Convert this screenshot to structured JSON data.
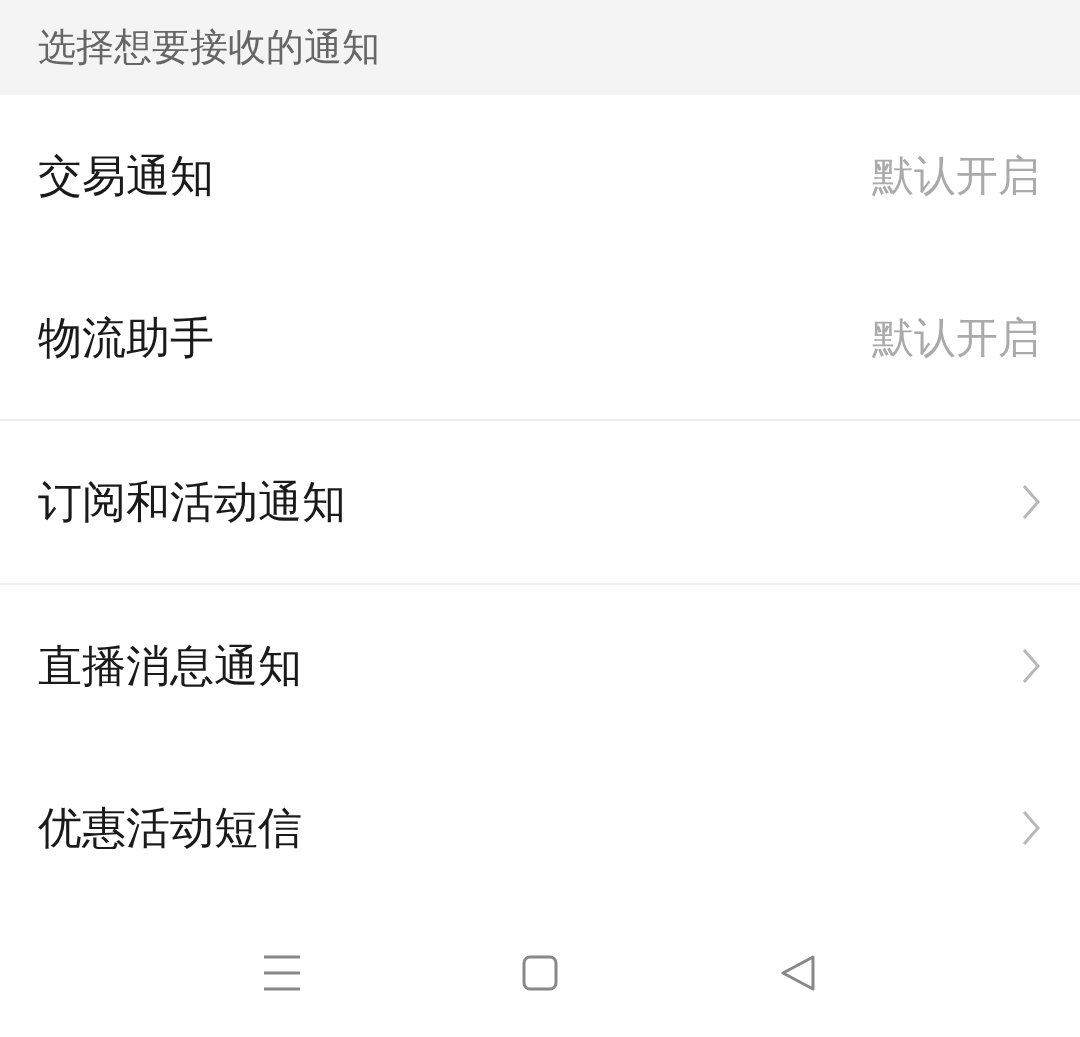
{
  "section_header": "选择想要接收的通知",
  "groups": [
    {
      "items": [
        {
          "label": "交易通知",
          "kind": "value",
          "value": "默认开启"
        },
        {
          "label": "物流助手",
          "kind": "value",
          "value": "默认开启"
        }
      ]
    },
    {
      "items": [
        {
          "label": "订阅和活动通知",
          "kind": "link"
        }
      ]
    },
    {
      "items": [
        {
          "label": "直播消息通知",
          "kind": "link"
        },
        {
          "label": "优惠活动短信",
          "kind": "link"
        }
      ]
    }
  ]
}
